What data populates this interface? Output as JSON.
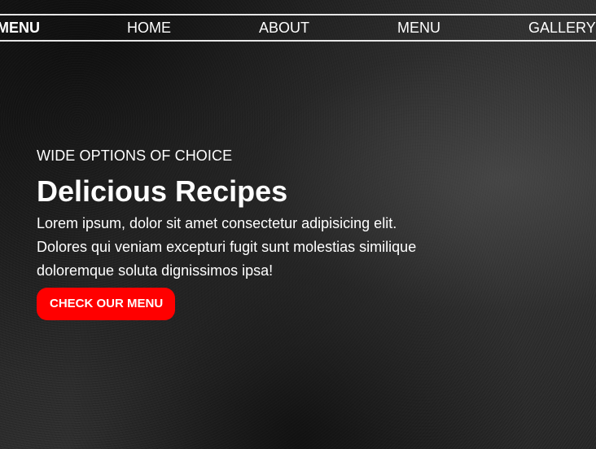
{
  "navbar": {
    "brand": "MENU",
    "links": [
      "HOME",
      "ABOUT",
      "MENU",
      "GALLERY"
    ]
  },
  "hero": {
    "kicker": "WIDE OPTIONS OF CHOICE",
    "title": "Delicious Recipes",
    "text_lines": [
      "Lorem ipsum, dolor sit amet consectetur adipisicing elit.",
      "Dolores qui veniam excepturi fugit sunt molestias similique",
      "doloremque soluta dignissimos ipsa!"
    ],
    "cta_label": "CHECK OUR MENU"
  },
  "colors": {
    "accent": "#ff0000",
    "text": "#ffffff",
    "background": "#2a2a2a"
  }
}
